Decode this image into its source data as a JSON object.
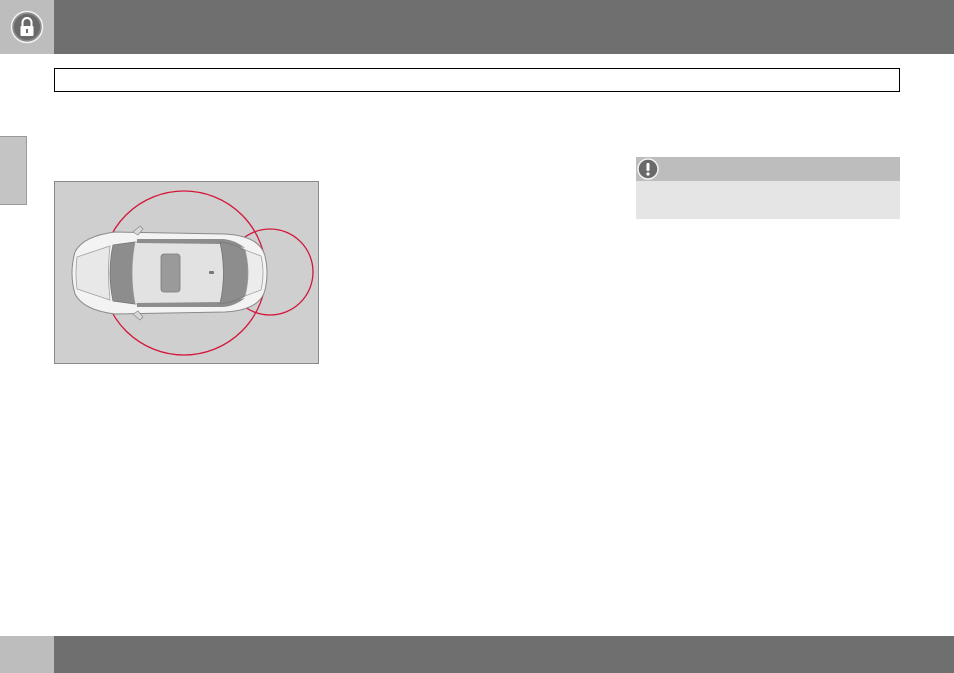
{
  "header": {
    "icon": "lock-icon",
    "title": ""
  },
  "section_tab": {
    "label": ""
  },
  "figure": {
    "icon": "car-top-view-keyless-range",
    "range_color": "#d2173b"
  },
  "warning": {
    "icon": "exclamation-icon",
    "heading": "",
    "text": ""
  },
  "footer": {
    "page_number": ""
  }
}
